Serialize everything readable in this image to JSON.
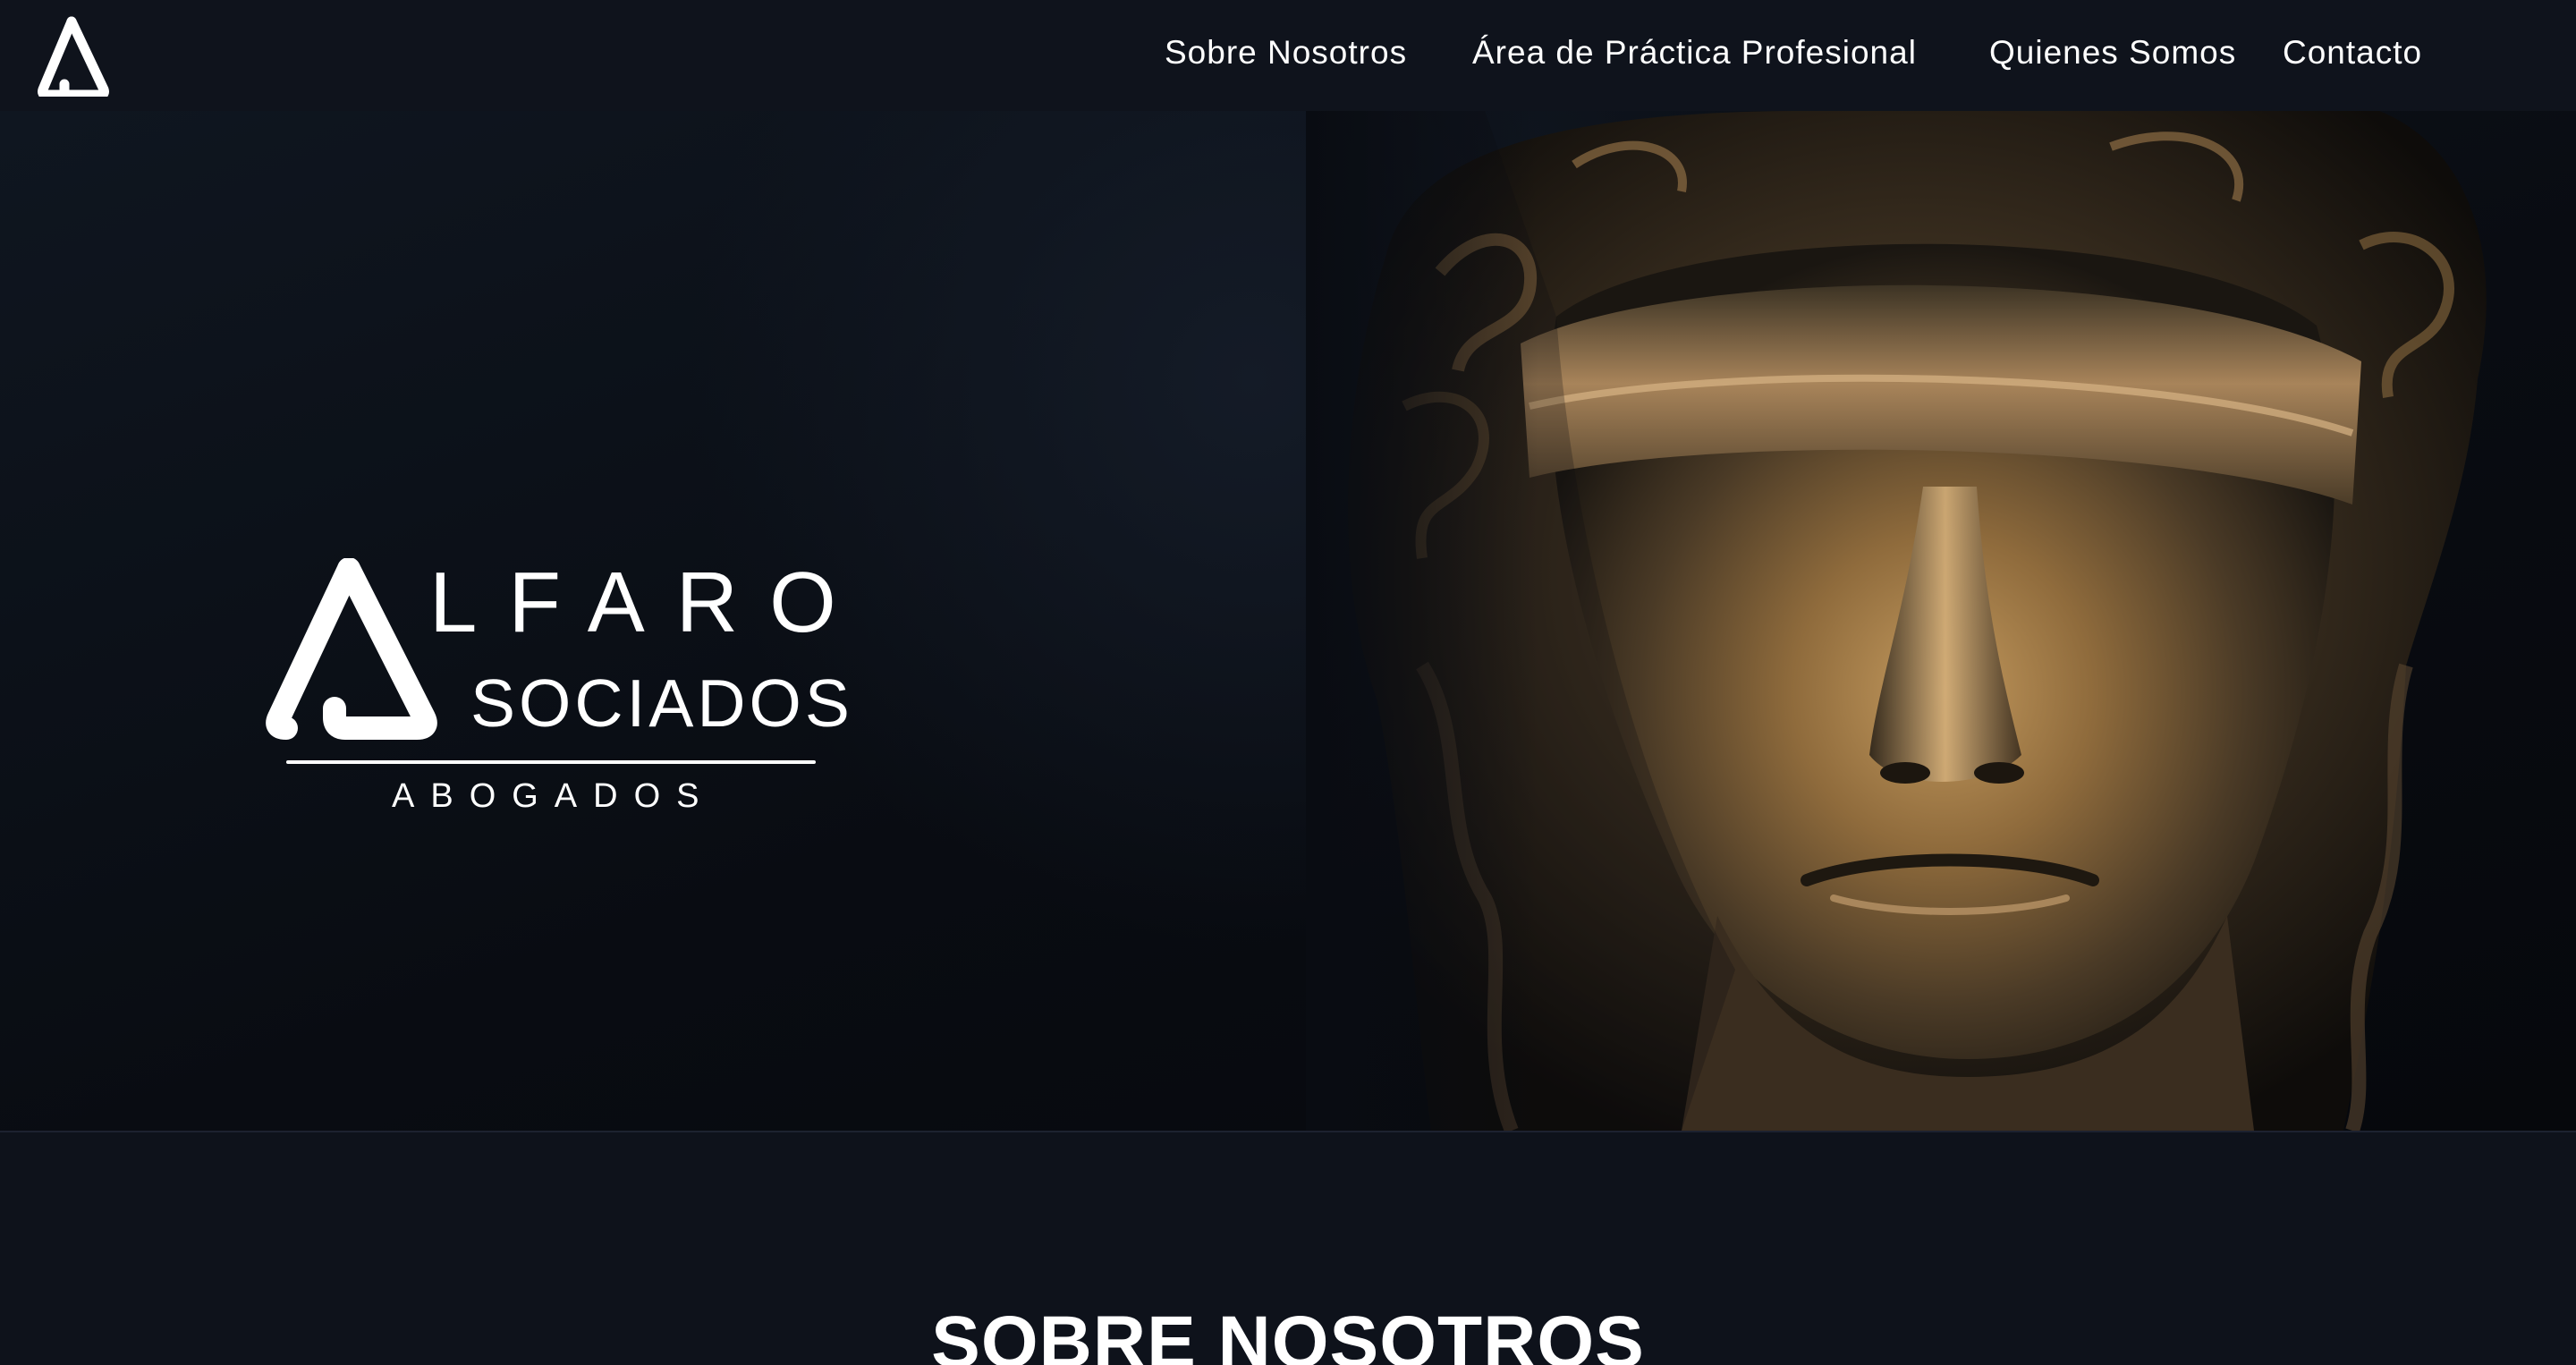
{
  "nav": {
    "logo_icon": "alfaro-triangle-logo-icon",
    "links": [
      {
        "label": "Sobre Nosotros"
      },
      {
        "label": "Área de Práctica Profesional"
      },
      {
        "label": "Quienes Somos"
      },
      {
        "label": "Contacto"
      }
    ]
  },
  "hero": {
    "brand": {
      "name": "LFARO",
      "sub": "SOCIADOS",
      "tag": "ABOGADOS"
    },
    "image": "blindfolded-lady-justice-bronze-statue"
  },
  "section": {
    "title": "SOBRE NOSOTROS"
  },
  "colors": {
    "background": "#0e121b",
    "topbar": "#0f131c",
    "text": "#ffffff",
    "bronze": "#9a7a4a"
  }
}
